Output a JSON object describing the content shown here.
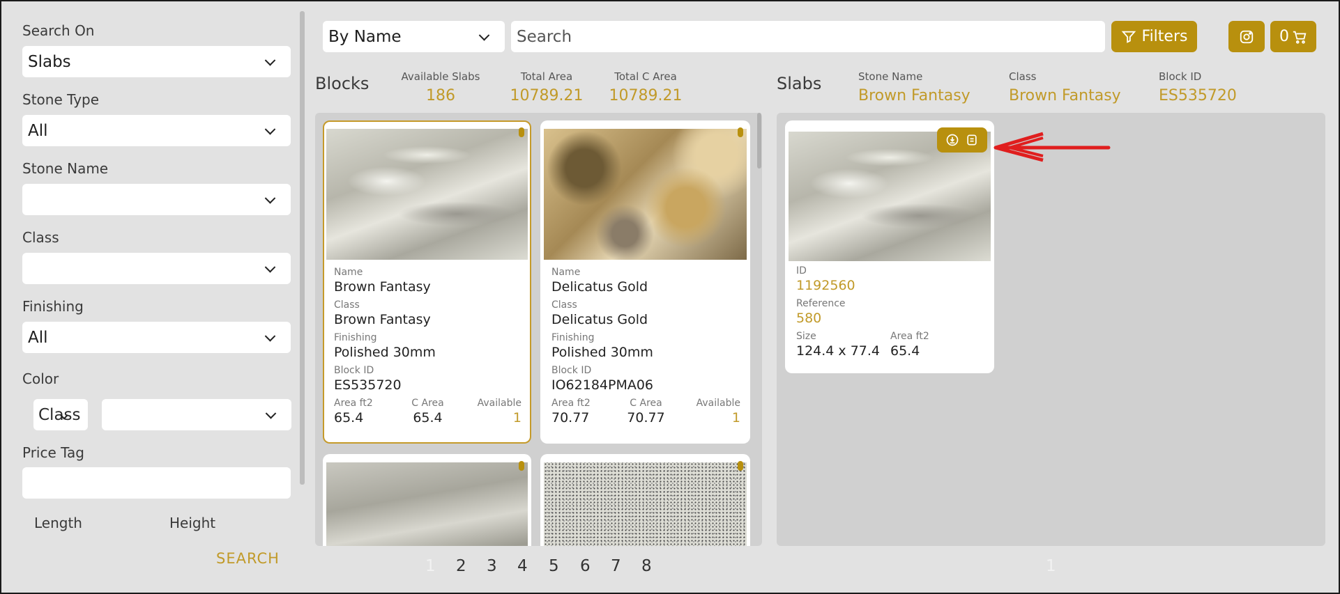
{
  "sidebar": {
    "search_on_label": "Search On",
    "search_on_value": "Slabs",
    "stone_type_label": "Stone Type",
    "stone_type_value": "All",
    "stone_name_label": "Stone Name",
    "stone_name_value": "",
    "class_label": "Class",
    "class_value": "",
    "finishing_label": "Finishing",
    "finishing_value": "All",
    "color_label": "Color",
    "color_mode_value": "Class",
    "color_value": "",
    "price_tag_label": "Price Tag",
    "length_label": "Length",
    "height_label": "Height",
    "search_button": "SEARCH"
  },
  "topbar": {
    "sort_value": "By Name",
    "search_placeholder": "Search",
    "filters_label": "Filters",
    "cart_count": "0",
    "accent": "#b8900e"
  },
  "blocks_header": {
    "title": "Blocks",
    "available_slabs_label": "Available Slabs",
    "available_slabs_value": "186",
    "total_area_label": "Total Area",
    "total_area_value": "10789.21",
    "total_c_area_label": "Total C Area",
    "total_c_area_value": "10789.21"
  },
  "slabs_header": {
    "title": "Slabs",
    "stone_name_label": "Stone Name",
    "stone_name_value": "Brown Fantasy",
    "class_label": "Class",
    "class_value": "Brown Fantasy",
    "block_id_label": "Block ID",
    "block_id_value": "ES535720"
  },
  "field_labels": {
    "name": "Name",
    "class": "Class",
    "finishing": "Finishing",
    "block_id": "Block ID",
    "area": "Area ft2",
    "c_area": "C Area",
    "available": "Available",
    "id": "ID",
    "reference": "Reference",
    "size": "Size"
  },
  "blocks": [
    {
      "name": "Brown Fantasy",
      "class": "Brown Fantasy",
      "finishing": "Polished 30mm",
      "block_id": "ES535720",
      "area": "65.4",
      "c_area": "65.4",
      "available": "1",
      "selected": true
    },
    {
      "name": "Delicatus Gold",
      "class": "Delicatus Gold",
      "finishing": "Polished 30mm",
      "block_id": "IO62184PMA06",
      "area": "70.77",
      "c_area": "70.77",
      "available": "1",
      "selected": false
    }
  ],
  "slab": {
    "id": "1192560",
    "reference": "580",
    "size": "124.4 x 77.4",
    "area": "65.4"
  },
  "blocks_pages": [
    "1",
    "2",
    "3",
    "4",
    "5",
    "6",
    "7",
    "8"
  ],
  "blocks_current_page": "1",
  "slabs_pages": [
    "1"
  ]
}
